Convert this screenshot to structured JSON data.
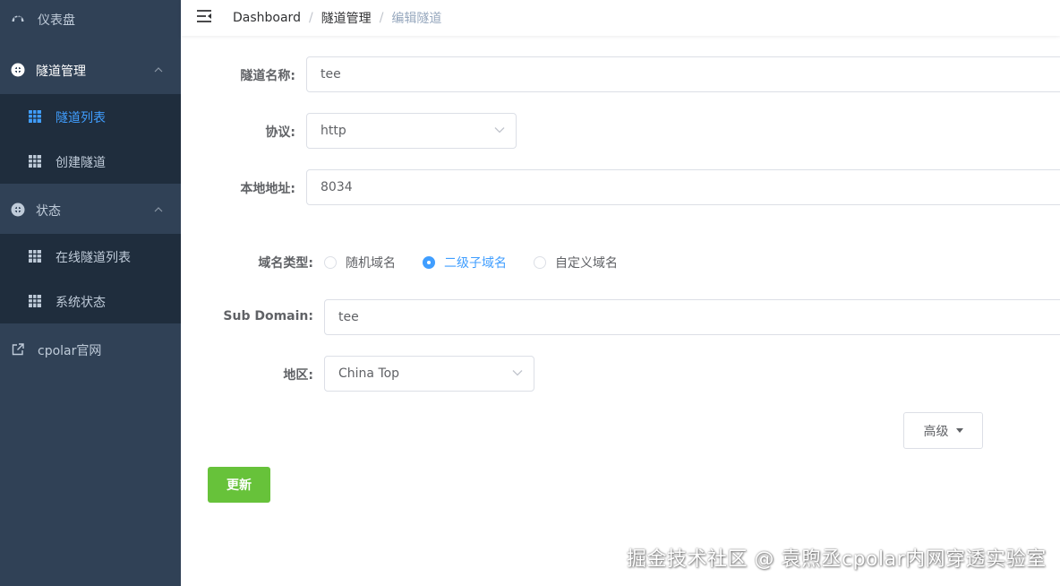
{
  "sidebar": {
    "dashboard": {
      "label": "仪表盘"
    },
    "tunnel_mgmt": {
      "label": "隧道管理",
      "items": [
        {
          "label": "隧道列表"
        },
        {
          "label": "创建隧道"
        }
      ]
    },
    "status": {
      "label": "状态",
      "items": [
        {
          "label": "在线隧道列表"
        },
        {
          "label": "系统状态"
        }
      ]
    },
    "website": {
      "label": "cpolar官网"
    }
  },
  "header": {
    "breadcrumb": [
      "Dashboard",
      "隧道管理",
      "编辑隧道"
    ],
    "separator": "/"
  },
  "form": {
    "tunnel_name": {
      "label": "隧道名称:",
      "value": "tee"
    },
    "protocol": {
      "label": "协议:",
      "value": "http"
    },
    "local_address": {
      "label": "本地地址:",
      "value": "8034"
    },
    "domain_type": {
      "label": "域名类型:",
      "options": [
        "随机域名",
        "二级子域名",
        "自定义域名"
      ],
      "selected": "二级子域名"
    },
    "sub_domain": {
      "label": "Sub Domain:",
      "value": "tee"
    },
    "region": {
      "label": "地区:",
      "value": "China Top"
    },
    "advanced_label": "高级",
    "update_label": "更新"
  },
  "watermark": "掘金技术社区 @ 袁煦丞cpolar内网穿透实验室",
  "colors": {
    "sidebar_bg": "#304156",
    "submenu_bg": "#1f2d3d",
    "sidebar_text": "#bfcbd9",
    "active": "#409eff",
    "primary_green": "#67c23a"
  },
  "icons": {
    "dashboard": "speedometer-icon",
    "tunnel_mgmt": "plus-circle-icon",
    "tunnel_list": "table-icon",
    "create_tunnel": "table-icon",
    "status": "plus-circle-icon",
    "online_list": "table-icon",
    "system_status": "table-icon",
    "website": "external-link-icon",
    "hamburger": "hamburger-icon"
  }
}
